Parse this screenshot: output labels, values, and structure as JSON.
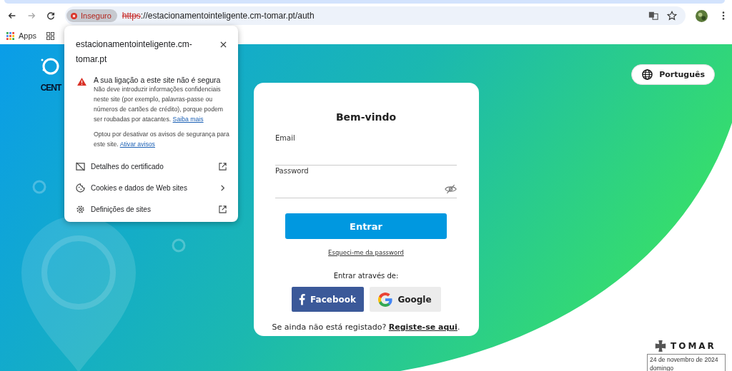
{
  "browser": {
    "security_chip": "Inseguro",
    "url_scheme": "https",
    "url_rest": "://estacionamentointeligente.cm-tomar.pt/auth",
    "bookmarks": [
      "Apps"
    ]
  },
  "site_popup": {
    "title": "estacionamentointeligente.cm-tomar.pt",
    "warning_title": "A sua ligação a este site não é segura",
    "warning_text": "Não deve introduzir informações confidenciais neste site (por exemplo, palavras-passe ou números de cartões de crédito), porque podem ser roubadas por atacantes.",
    "warning_link": "Saiba mais",
    "notice_text": "Optou por desativar os avisos de segurança para este site.",
    "notice_link": "Ativar avisos",
    "items": [
      {
        "label": "Detalhes do certificado",
        "kind": "certificate"
      },
      {
        "label": "Cookies e dados de Web sites",
        "kind": "cookie"
      },
      {
        "label": "Definições de sites",
        "kind": "settings"
      }
    ]
  },
  "page": {
    "logo_text": "CENT",
    "language": "Português",
    "card": {
      "title": "Bem-vindo",
      "fields": [
        {
          "label": "Email",
          "kind": "text"
        },
        {
          "label": "Password",
          "kind": "password"
        }
      ],
      "submit": "Entrar",
      "forgot_link": "Esqueci-me da password",
      "social_label": "Entrar através de:",
      "social_buttons": [
        {
          "label": "Facebook",
          "kind": "facebook"
        },
        {
          "label": "Google",
          "kind": "google"
        }
      ],
      "register_prompt": "Se ainda não está registado?",
      "register_link": "Registe-se aqui",
      "register_end": "."
    },
    "brand": "TOMAR"
  },
  "date_tooltip": [
    "24 de novembro de 2024",
    "domingo"
  ]
}
